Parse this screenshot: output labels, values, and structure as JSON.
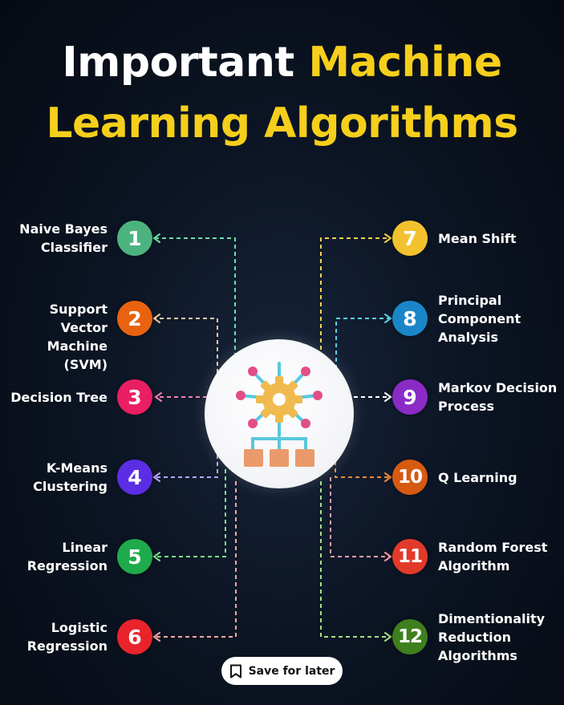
{
  "title": {
    "line1_white": "Important",
    "line1_yellow": "Machine",
    "line2_yellow": "Learning Algorithms"
  },
  "algorithms": [
    {
      "number": "1",
      "name_lines": [
        "Naive Bayes",
        "Classifier"
      ],
      "color": "#4db37e"
    },
    {
      "number": "2",
      "name_lines": [
        "Support Vector",
        "Machine (SVM)"
      ],
      "color": "#e8620f"
    },
    {
      "number": "3",
      "name_lines": [
        "Decision Tree"
      ],
      "color": "#e91e63"
    },
    {
      "number": "4",
      "name_lines": [
        "K-Means",
        "Clustering"
      ],
      "color": "#5b2ee6"
    },
    {
      "number": "5",
      "name_lines": [
        "Linear",
        "Regression"
      ],
      "color": "#1faa4b"
    },
    {
      "number": "6",
      "name_lines": [
        "Logistic",
        "Regression"
      ],
      "color": "#e8232c"
    },
    {
      "number": "7",
      "name_lines": [
        "Mean Shift"
      ],
      "color": "#f2c22e"
    },
    {
      "number": "8",
      "name_lines": [
        "Principal",
        "Component",
        "Analysis"
      ],
      "color": "#1a86c8"
    },
    {
      "number": "9",
      "name_lines": [
        "Markov Decision",
        "Process"
      ],
      "color": "#8a2bc6"
    },
    {
      "number": "10",
      "name_lines": [
        "Q Learning"
      ],
      "color": "#d65a12"
    },
    {
      "number": "11",
      "name_lines": [
        "Random Forest",
        "Algorithm"
      ],
      "color": "#e23a2a"
    },
    {
      "number": "12",
      "name_lines": [
        "Dimentionality",
        "Reduction",
        "Algorithms"
      ],
      "color": "#3f7f1e"
    }
  ],
  "connector_colors": {
    "1": "#6ee0a4",
    "2": "#f5c7a0",
    "3": "#f07fb4",
    "4": "#b8a6f2",
    "5": "#7fe08a",
    "6": "#f5a7a7",
    "7": "#f2d24a",
    "8": "#5ad0e8",
    "9": "#ffffff",
    "10": "#f08a3a",
    "11": "#f59aa6",
    "12": "#a6e07f"
  },
  "hub": {
    "icon": "gear-network-icon",
    "colors": {
      "gear": "#f0ba4e",
      "nodes": "#e24e86",
      "lines": "#58c8dc",
      "boxes": "#ea9a6a"
    }
  },
  "save_button": {
    "label": "Save for later",
    "icon": "bookmark-icon"
  }
}
